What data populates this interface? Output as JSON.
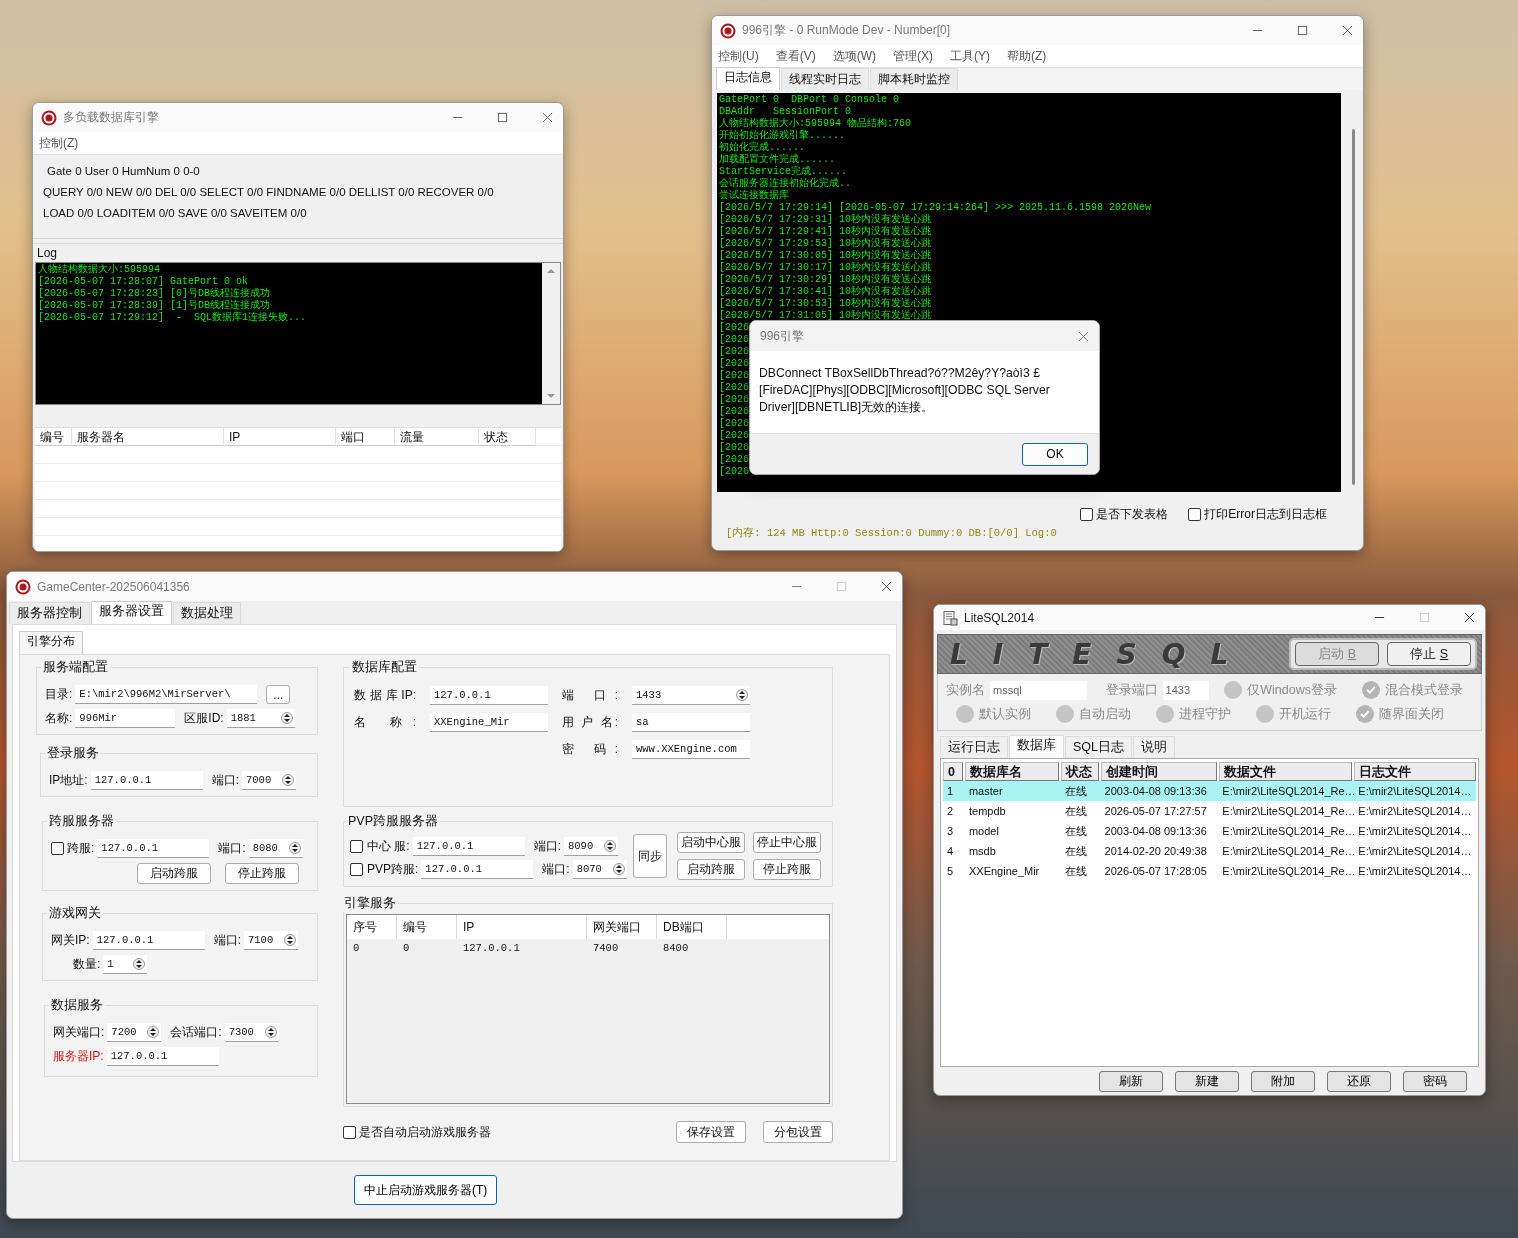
{
  "db_window": {
    "title": "多负载数据库引擎",
    "menu": [
      "控制(Z)"
    ],
    "stats": [
      "Gate 0 User 0 HumNum 0 0-0",
      "QUERY 0/0 NEW 0/0 DEL 0/0 SELECT 0/0 FINDNAME 0/0 DELLIST 0/0 RECOVER 0/0",
      "LOAD 0/0 LOADITEM 0/0 SAVE 0/0 SAVEITEM 0/0"
    ],
    "log_label": "Log",
    "log_lines": [
      "人物结构数据大小:595994",
      "[2026-05-07 17:28:07] GatePort 0 ok",
      "[2026-05-07 17:28:23] [0]号DB线程连接成功",
      "[2026-05-07 17:28:39] [1]号DB线程连接成功",
      "[2026-05-07 17:29:12]  -  SQL数据库1连接失败..."
    ],
    "table": {
      "columns": [
        "编号",
        "服务器名",
        "IP",
        "端口",
        "流量",
        "状态"
      ]
    }
  },
  "engine_window": {
    "title": "996引擎 - 0 RunMode Dev - Number[0]",
    "menu": [
      "控制(U)",
      "查看(V)",
      "选项(W)",
      "管理(X)",
      "工具(Y)",
      "帮助(Z)"
    ],
    "tabs": [
      {
        "label": "日志信息",
        "selected": true
      },
      {
        "label": "线程实时日志",
        "selected": false
      },
      {
        "label": "脚本耗时监控",
        "selected": false
      }
    ],
    "log_lines": [
      "GatePort 0  DBPort 0 Console 0",
      "DBAddr   SessionPort 0",
      "人物结构数据大小:595994 物品结构:760",
      "开始初始化游戏引擎......",
      "初始化完成......",
      "加载配置文件完成......",
      "StartService完成......",
      "会话服务器连接初始化完成..",
      "尝试连接数据库",
      "[2026/5/7 17:29:14] [2026-05-07 17:29:14:264] >>> 2025.11.6.1598 2026New",
      "[2026/5/7 17:29:31] 10秒内没有发送心跳",
      "[2026/5/7 17:29:41] 10秒内没有发送心跳",
      "[2026/5/7 17:29:53] 10秒内没有发送心跳",
      "[2026/5/7 17:30:05] 10秒内没有发送心跳",
      "[2026/5/7 17:30:17] 10秒内没有发送心跳",
      "[2026/5/7 17:30:29] 10秒内没有发送心跳",
      "[2026/5/7 17:30:41] 10秒内没有发送心跳",
      "[2026/5/7 17:30:53] 10秒内没有发送心跳",
      "[2026/5/7 17:31:05] 10秒内没有发送心跳",
      "[2026",
      "[2026",
      "[2026",
      "[2026",
      "[2026",
      "[2026",
      "[2026",
      "[2026",
      "[2026",
      "[2026",
      "[2026",
      "[2026",
      "[2026"
    ],
    "options": [
      {
        "label": "是否下发表格",
        "checked": false
      },
      {
        "label": "打印Error日志到日志框",
        "checked": false
      }
    ],
    "status": "[内存: 124 MB Http:0 Session:0 Dummy:0 DB:[0/0] Log:0",
    "dialog": {
      "title": "996引擎",
      "message": "DBConnect TBoxSellDbThread?ó??M2êy?Y?aòì3 £ [FireDAC][Phys][ODBC][Microsoft][ODBC SQL Server Driver][DBNETLIB]无效的连接。",
      "button": "OK"
    }
  },
  "game_center_window": {
    "title": "GameCenter-202506041356",
    "tabs": [
      {
        "label": "服务器控制",
        "selected": false
      },
      {
        "label": "服务器设置",
        "selected": true
      },
      {
        "label": "数据处理",
        "selected": false
      }
    ],
    "subtabs": [
      {
        "label": "引擎分布",
        "selected": true
      }
    ],
    "server_config": {
      "title": "服务端配置",
      "dir": {
        "label": "目录:",
        "value": "E:\\mir2\\996M2\\MirServer\\"
      },
      "browse": "...",
      "name": {
        "label": "名称:",
        "value": "996Mir"
      },
      "zone": {
        "label": "区服ID:",
        "value": "1881"
      }
    },
    "login_service": {
      "title": "登录服务",
      "ip": {
        "label": "IP地址:",
        "value": "127.0.0.1"
      },
      "port": {
        "label": "端口:",
        "value": "7000"
      }
    },
    "cross_server": {
      "title": "跨服服务器",
      "enable": {
        "label": "跨服:",
        "checked": false
      },
      "ip": "127.0.0.1",
      "port": {
        "label": "端口:",
        "value": "8080"
      },
      "buttons": [
        "启动跨服",
        "停止跨服"
      ]
    },
    "game_gateway": {
      "title": "游戏网关",
      "ip": {
        "label": "网关IP:",
        "value": "127.0.0.1"
      },
      "port": {
        "label": "端口:",
        "value": "7100"
      },
      "count": {
        "label": "数量:",
        "value": "1"
      }
    },
    "data_service": {
      "title": "数据服务",
      "gate_port": {
        "label": "网关端口:",
        "value": "7200"
      },
      "session_port": {
        "label": "会话端口:",
        "value": "7300"
      },
      "server_ip": {
        "label": "服务器IP:",
        "value": "127.0.0.1",
        "warning": true
      }
    },
    "database_config": {
      "title": "数据库配置",
      "ip": {
        "label": "数据库IP:",
        "value": "127.0.0.1"
      },
      "port": {
        "label": "端 口:",
        "value": "1433"
      },
      "name": {
        "label": "名 称:",
        "value": "XXEngine_Mir"
      },
      "user": {
        "label": "用 户 名:",
        "value": "sa"
      },
      "password": {
        "label": "密 码:",
        "value": "www.XXEngine.com"
      }
    },
    "pvp": {
      "title": "PVP跨服服务器",
      "servers": [
        {
          "label": "中心 服:",
          "checked": false,
          "ip": "127.0.0.1",
          "port_label": "端口:",
          "port": "8090"
        },
        {
          "label": "PVP跨服:",
          "checked": false,
          "ip": "127.0.0.1",
          "port_label": "端口:",
          "port": "8070"
        }
      ],
      "sync": "同步",
      "buttons": [
        "启动中心服",
        "停止中心服",
        "启动跨服",
        "停止跨服"
      ]
    },
    "engine_service": {
      "title": "引擎服务",
      "columns": [
        "序号",
        "编号",
        "IP",
        "网关端口",
        "DB端口"
      ],
      "rows": [
        [
          "0",
          "0",
          "127.0.0.1",
          "7400",
          "8400"
        ]
      ]
    },
    "auto_start": {
      "label": "是否自动启动游戏服务器",
      "checked": false
    },
    "actions": [
      "保存设置",
      "分包设置"
    ],
    "stop_button": "中止启动游戏服务器(T)"
  },
  "litesql_window": {
    "title": "LiteSQL2014",
    "logo": "LITESQL",
    "start_button": {
      "label": "启动",
      "hotkey": "B",
      "disabled": true
    },
    "stop_button": {
      "label": "停止",
      "hotkey": "S",
      "disabled": false
    },
    "settings_disabled": true,
    "instance": {
      "label": "实例名",
      "value": "mssql"
    },
    "port": {
      "label": "登录端口",
      "value": "1433"
    },
    "options": [
      {
        "label": "仅Windows登录",
        "checked": false
      },
      {
        "label": "混合模式登录",
        "checked": true
      },
      {
        "label": "默认实例",
        "checked": false
      },
      {
        "label": "自动启动",
        "checked": false
      },
      {
        "label": "进程守护",
        "checked": false
      },
      {
        "label": "开机运行",
        "checked": false
      },
      {
        "label": "随界面关闭",
        "checked": true
      }
    ],
    "tabs": [
      {
        "label": "运行日志",
        "selected": false
      },
      {
        "label": "数据库",
        "selected": true
      },
      {
        "label": "SQL日志",
        "selected": false
      },
      {
        "label": "说明",
        "selected": false
      }
    ],
    "table": {
      "columns": [
        "0",
        "数据库名",
        "状态",
        "创建时间",
        "数据文件",
        "日志文件"
      ],
      "rows": [
        {
          "cells": [
            "1",
            "master",
            "在线",
            "2003-04-08 09:13:36",
            "E:\\mir2\\LiteSQL2014_Re…",
            "E:\\mir2\\LiteSQL2014…"
          ],
          "selected": true
        },
        {
          "cells": [
            "2",
            "tempdb",
            "在线",
            "2026-05-07 17:27:57",
            "E:\\mir2\\LiteSQL2014_Re…",
            "E:\\mir2\\LiteSQL2014…"
          ],
          "selected": false
        },
        {
          "cells": [
            "3",
            "model",
            "在线",
            "2003-04-08 09:13:36",
            "E:\\mir2\\LiteSQL2014_Re…",
            "E:\\mir2\\LiteSQL2014…"
          ],
          "selected": false
        },
        {
          "cells": [
            "4",
            "msdb",
            "在线",
            "2014-02-20 20:49:38",
            "E:\\mir2\\LiteSQL2014_Re…",
            "E:\\mir2\\LiteSQL2014…"
          ],
          "selected": false
        },
        {
          "cells": [
            "5",
            "XXEngine_Mir",
            "在线",
            "2026-05-07 17:28:05",
            "E:\\mir2\\LiteSQL2014_Re…",
            "E:\\mir2\\LiteSQL2014…"
          ],
          "selected": false
        }
      ]
    },
    "buttons": [
      "刷新",
      "新建",
      "附加",
      "还原",
      "密码"
    ]
  }
}
